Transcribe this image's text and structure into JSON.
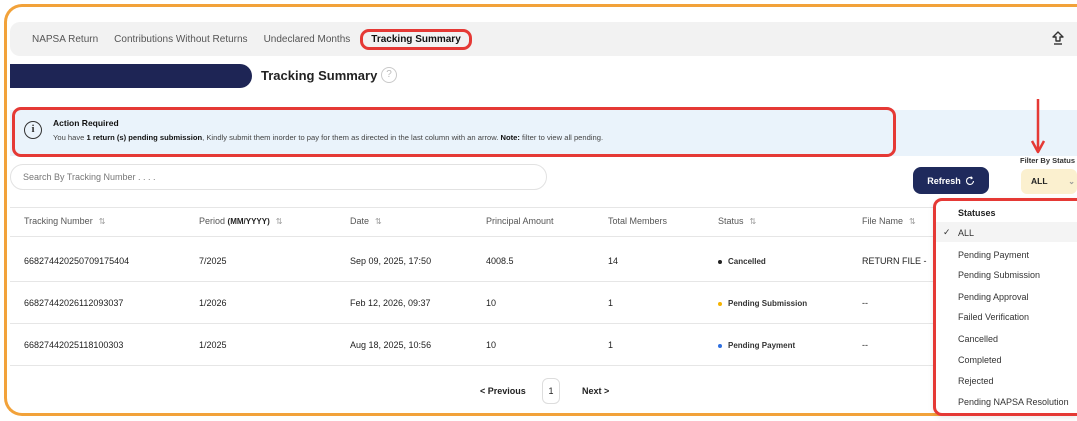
{
  "nav": {
    "tabs": [
      "NAPSA Return",
      "Contributions Without Returns",
      "Undeclared Months",
      "Tracking Summary"
    ],
    "active_tab": "Tracking Summary"
  },
  "header": {
    "title": "Tracking Summary"
  },
  "alert": {
    "title": "Action Required",
    "text_prefix": "You have ",
    "text_bold": "1 return (s) pending submission",
    "text_mid": ", Kindly submit them inorder to pay for them as directed in the last column with an arrow. ",
    "note_label": "Note:",
    "note_text": " filter to view all pending."
  },
  "search": {
    "placeholder": "Search By Tracking Number . . . ."
  },
  "controls": {
    "refresh_label": "Refresh",
    "filter_label": "Filter By Status",
    "filter_value": "ALL"
  },
  "table": {
    "headers": {
      "tracking": "Tracking Number",
      "period": "Period",
      "period_fmt": "(MM/YYYY)",
      "date": "Date",
      "principal": "Principal Amount",
      "members": "Total Members",
      "status": "Status",
      "file": "File Name"
    },
    "rows": [
      {
        "tracking": "668274420250709175404",
        "period": "7/2025",
        "date": "Sep 09, 2025, 17:50",
        "principal": "4008.5",
        "members": "14",
        "status": "Cancelled",
        "file": "RETURN FILE -"
      },
      {
        "tracking": "668274420261120930​37",
        "period": "1/2026",
        "date": "Feb 12, 2026, 09:37",
        "principal": "10",
        "members": "1",
        "status": "Pending Submission",
        "file": "--"
      },
      {
        "tracking": "668274420251181003​03",
        "period": "1/2025",
        "date": "Aug 18, 2025, 10:56",
        "principal": "10",
        "members": "1",
        "status": "Pending Payment",
        "file": "--"
      }
    ]
  },
  "pagination": {
    "prev": "< Previous",
    "page": "1",
    "next": "Next >"
  },
  "dropdown": {
    "header": "Statuses",
    "items": [
      "ALL",
      "Pending Payment",
      "Pending Submission",
      "Pending Approval",
      "Failed Verification",
      "Cancelled",
      "Completed",
      "Rejected",
      "Pending NAPSA Resolution"
    ],
    "selected": "ALL"
  },
  "colors": {
    "accent_frame": "#f2a23a",
    "highlight": "#e53935",
    "primary_button": "#1f2a5c",
    "status_cancelled": "#222222",
    "status_pending_submission": "#f5b301",
    "status_pending_payment": "#2f6fe0"
  }
}
